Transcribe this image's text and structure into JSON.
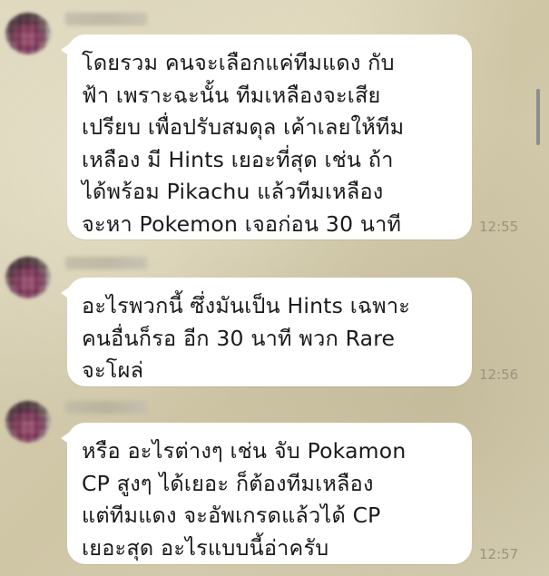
{
  "chat": {
    "messages": [
      {
        "text": "โดยรวม คนจะเลือกแค่ทีมแดง กับ\nฟ้า เพราะฉะนั้น ทีมเหลืองจะเสีย\nเปรียบ เพื่อปรับสมดุล เค้าเลยให้ทีม\nเหลือง มี Hints เยอะที่สุด เช่น ถ้า\nได้พร้อม Pikachu แล้วทีมเหลือง\nจะหา Pokemon เจอก่อน 30 นาที",
        "time": "12:55"
      },
      {
        "text": "อะไรพวกนี้ ซึ่งมันเป็น Hints เฉพาะ\nคนอื่นก็รอ อีก 30 นาที พวก Rare\nจะโผล่",
        "time": "12:56"
      },
      {
        "text": "หรือ อะไรต่างๆ เช่น จับ Pokamon\nCP สูงๆ ได้เยอะ ก็ต้องทีมเหลือง\nแต่ทีมแดง จะอัพเกรดแล้วได้ CP\nเยอะสุด อะไรแบบนี้อ่าครับ",
        "time": "12:57"
      }
    ]
  },
  "colors": {
    "bubble": "#ffffff",
    "timestamp": "#9a947f",
    "text": "#1a1a1a"
  }
}
